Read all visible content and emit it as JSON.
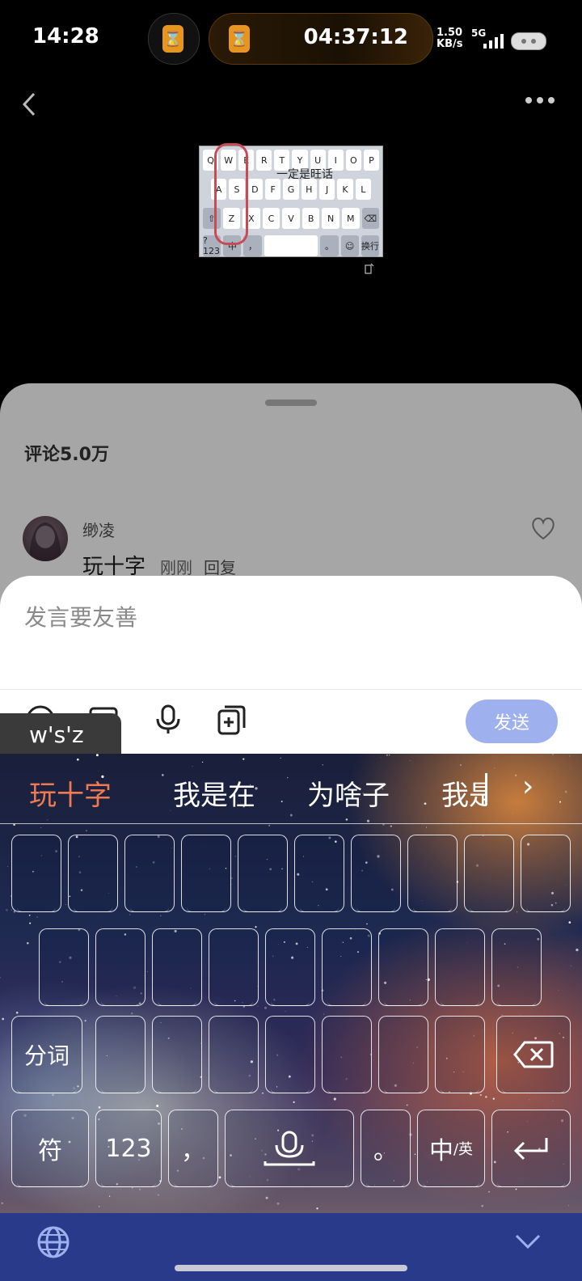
{
  "status": {
    "time": "14:28",
    "timer": "04:37:12",
    "speed_value": "1.50",
    "speed_unit": "KB/s",
    "network": "5G"
  },
  "post_image": {
    "row1": [
      "Q",
      "W",
      "E",
      "R",
      "T",
      "Y",
      "U",
      "I",
      "O",
      "P"
    ],
    "row2": [
      "A",
      "S",
      "D",
      "F",
      "G",
      "H",
      "J",
      "K",
      "L"
    ],
    "row3": [
      "⇧",
      "Z",
      "X",
      "C",
      "V",
      "B",
      "N",
      "M",
      "⌫"
    ],
    "row4": [
      "?123",
      "中",
      "，",
      "",
      "。",
      "☺",
      "换行"
    ],
    "handwriting": "一定是旺话"
  },
  "comments": {
    "count_label": "评论5.0万",
    "items": [
      {
        "user": "缈凌",
        "text": "玩十字",
        "time": "刚刚",
        "reply": "回复"
      }
    ]
  },
  "composer": {
    "placeholder": "发言要友善",
    "send_label": "发送",
    "pinyin_preview": "w's'z"
  },
  "keyboard": {
    "candidates": [
      "玩十字",
      "我是在",
      "为啥子",
      "我是"
    ],
    "segment_label": "分词",
    "symbol_label": "符",
    "numbers_label": "123",
    "comma": "，",
    "period": "。",
    "lang_main": "中",
    "lang_sub": "/英"
  },
  "colors": {
    "accent_candidate": "#ef7a52",
    "send_button": "#9fb0ee",
    "bottom_bar": "#2a3a8a",
    "timer_accent": "#e8951f"
  },
  "icons": [
    "back-icon",
    "more-icon",
    "hourglass-icon",
    "heart-icon",
    "emoji-icon",
    "image-icon",
    "microphone-icon",
    "sticker-icon",
    "backspace-icon",
    "enter-icon",
    "globe-icon",
    "hide-keyboard-icon"
  ]
}
